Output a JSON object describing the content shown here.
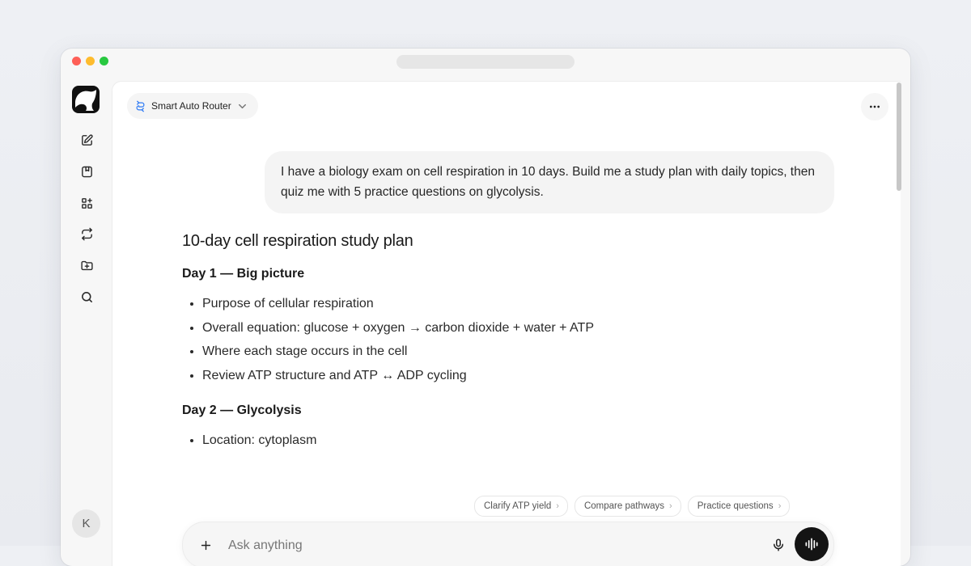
{
  "sidebar": {
    "items": [
      {
        "name": "new-chat",
        "icon": "edit-icon"
      },
      {
        "name": "library",
        "icon": "book-icon"
      },
      {
        "name": "apps",
        "icon": "grid-plus-icon"
      },
      {
        "name": "swap",
        "icon": "repeat-icon"
      },
      {
        "name": "folder",
        "icon": "folder-plus-icon"
      },
      {
        "name": "search",
        "icon": "search-icon"
      }
    ],
    "avatar_initial": "K"
  },
  "header": {
    "model_label": "Smart Auto Router"
  },
  "conversation": {
    "user_message": "I have a biology exam on cell respiration in 10 days. Build me a study plan with daily topics, then quiz me with 5 practice questions on glycolysis.",
    "answer_title": "10-day cell respiration study plan",
    "days": [
      {
        "heading": "Day 1 — Big picture",
        "bullets": [
          "Purpose of cellular respiration",
          "Overall equation: glucose + oxygen → carbon dioxide + water + ATP",
          "Where each stage occurs in the cell",
          "Review ATP structure and ATP ↔ ADP cycling"
        ]
      },
      {
        "heading": "Day 2 — Glycolysis",
        "bullets": [
          "Location: cytoplasm"
        ]
      }
    ]
  },
  "suggestions": [
    "Clarify ATP yield",
    "Compare pathways",
    "Practice questions"
  ],
  "composer": {
    "placeholder": "Ask anything"
  },
  "colors": {
    "accent_router": "#2f7bf5",
    "voice_button": "#141414"
  }
}
